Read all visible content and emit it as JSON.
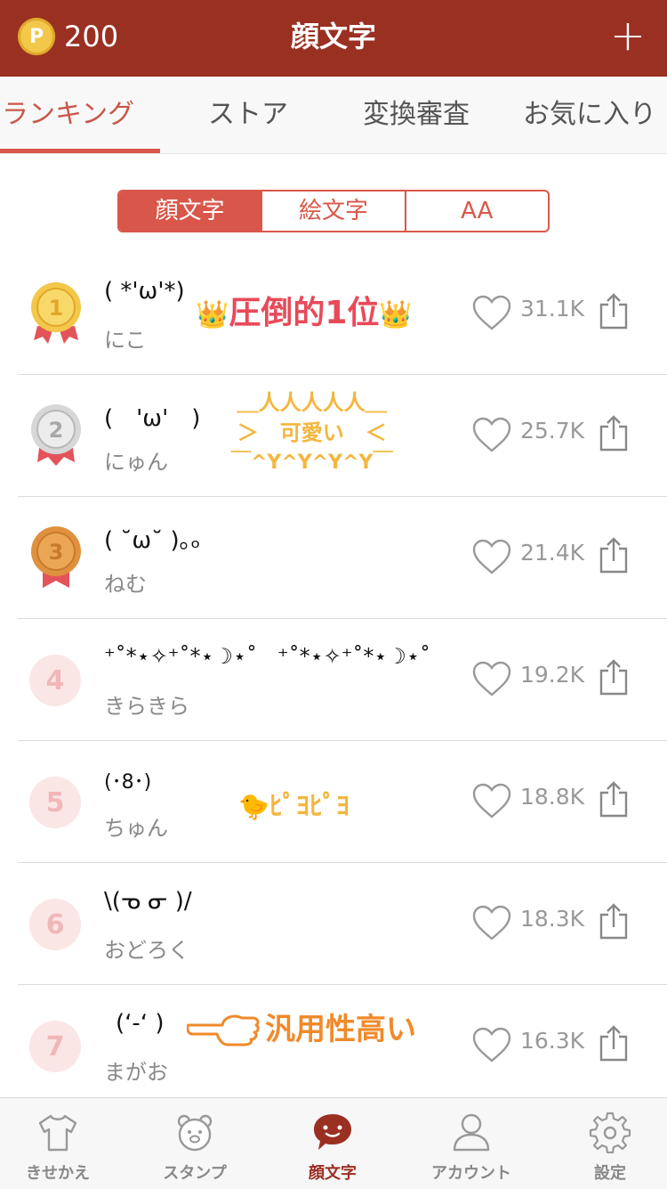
{
  "header": {
    "coin_icon": "P",
    "coin_count": "200",
    "title": "顔文字",
    "add_label": "+"
  },
  "tabs": [
    {
      "label": "ランキング",
      "active": true
    },
    {
      "label": "ストア"
    },
    {
      "label": "変換審査"
    },
    {
      "label": "お気に入り"
    }
  ],
  "segments": [
    {
      "label": "顔文字",
      "active": true
    },
    {
      "label": "絵文字"
    },
    {
      "label": "AA"
    }
  ],
  "rows": [
    {
      "rank": "1",
      "kaomoji": "( *'ω'*)",
      "name": "にこ",
      "likes": "31.1K"
    },
    {
      "rank": "2",
      "kaomoji": "(　'ω'　)",
      "name": "にゅん",
      "likes": "25.7K"
    },
    {
      "rank": "3",
      "kaomoji": "( ˘ω˘ )｡ₒ",
      "name": "ねむ",
      "likes": "21.4K"
    },
    {
      "rank": "4",
      "kaomoji": "⁺˚*⋆✧⁺˚*⋆☽⋆˚   ⁺˚*⋆✧⁺˚*⋆☽⋆˚",
      "name": "きらきら",
      "likes": "19.2K"
    },
    {
      "rank": "5",
      "kaomoji": "(･8･)",
      "name": "ちゅん",
      "likes": "18.8K"
    },
    {
      "rank": "6",
      "kaomoji": "\\(ᓀ ᓂ )/",
      "name": "おどろく",
      "likes": "18.3K"
    },
    {
      "rank": "7",
      "kaomoji": "(ʻ-ʻ )",
      "name": "まがお",
      "likes": "16.3K"
    }
  ],
  "annotations": {
    "first": "圧倒的1位",
    "second_top": "＿人人人人人＿",
    "second_mid": "＞　可愛い　＜",
    "second_bottom": "￣^Y^Y^Y^Y￣",
    "fifth": "ﾋﾟﾖﾋﾟﾖ",
    "seventh": "汎用性高い"
  },
  "bottom_nav": [
    {
      "label": "きせかえ",
      "icon": "tshirt-icon"
    },
    {
      "label": "スタンプ",
      "icon": "bear-icon"
    },
    {
      "label": "顔文字",
      "icon": "speech-smile-icon",
      "active": true
    },
    {
      "label": "アカウント",
      "icon": "person-icon"
    },
    {
      "label": "設定",
      "icon": "gear-icon"
    }
  ],
  "colors": {
    "brand": "#9a3022",
    "accent": "#d9574a",
    "gold": "#f3c74a",
    "silver": "#d7d7d7",
    "bronze": "#e0913f"
  }
}
